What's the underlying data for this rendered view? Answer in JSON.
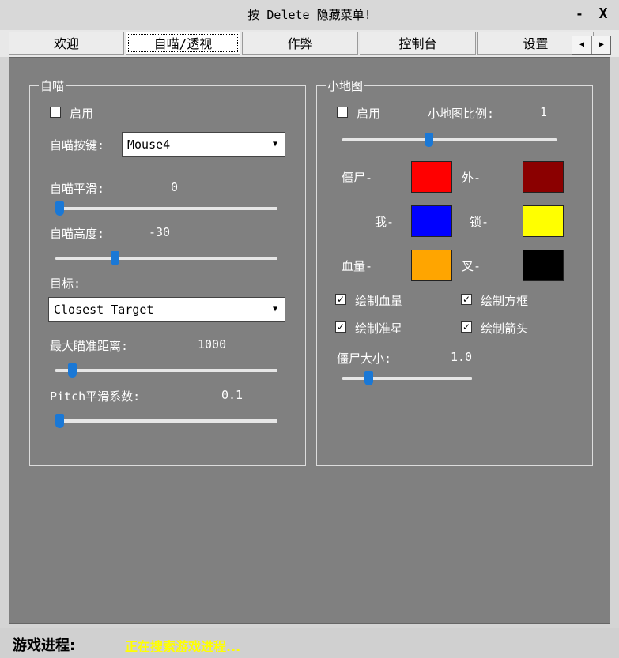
{
  "window": {
    "title": "按 Delete 隐藏菜单!",
    "minimize": "-",
    "close": "X"
  },
  "tabs": [
    "欢迎",
    "自喵/透视",
    "作弊",
    "控制台",
    "设置"
  ],
  "active_tab": 1,
  "tab_scroll": {
    "left": "◀",
    "right": "▶"
  },
  "aimbot": {
    "title": "自喵",
    "enable_label": "启用",
    "enabled": false,
    "key_label": "自喵按键:",
    "key_value": "Mouse4",
    "smooth_label": "自喵平滑:",
    "smooth_value": "0",
    "smooth_level": 0.0,
    "height_label": "自喵高度:",
    "height_value": "-30",
    "height_level": 0.26,
    "target_label": "目标:",
    "target_value": "Closest Target",
    "max_dist_label": "最大瞄准距离:",
    "max_dist_value": "1000",
    "max_dist_level": 0.06,
    "pitch_label": "Pitch平滑系数:",
    "pitch_value": "0.1",
    "pitch_level": 0.0
  },
  "minimap": {
    "title": "小地图",
    "enable_label": "启用",
    "enabled": false,
    "scale_label": "小地图比例:",
    "scale_value": "1",
    "scale_level": 0.4,
    "zombie_label": "僵尸-",
    "outside_label": "外-",
    "me_label": "我-",
    "lock_label": "锁-",
    "health_label": "血量-",
    "cross_label": "叉-",
    "colors": {
      "zombie": "#ff0000",
      "outside": "#8b0000",
      "me": "#0000ff",
      "lock": "#ffff00",
      "health": "#ffa500",
      "cross": "#000000"
    },
    "draw_health": "绘制血量",
    "draw_box": "绘制方框",
    "draw_crosshair": "绘制准星",
    "draw_arrow": "绘制箭头",
    "zombie_size_label": "僵尸大小:",
    "zombie_size_value": "1.0",
    "zombie_size_level": 0.18
  },
  "checked_mark": "✓",
  "status": {
    "label": "游戏进程:",
    "value": "正在搜索游戏进程..."
  }
}
